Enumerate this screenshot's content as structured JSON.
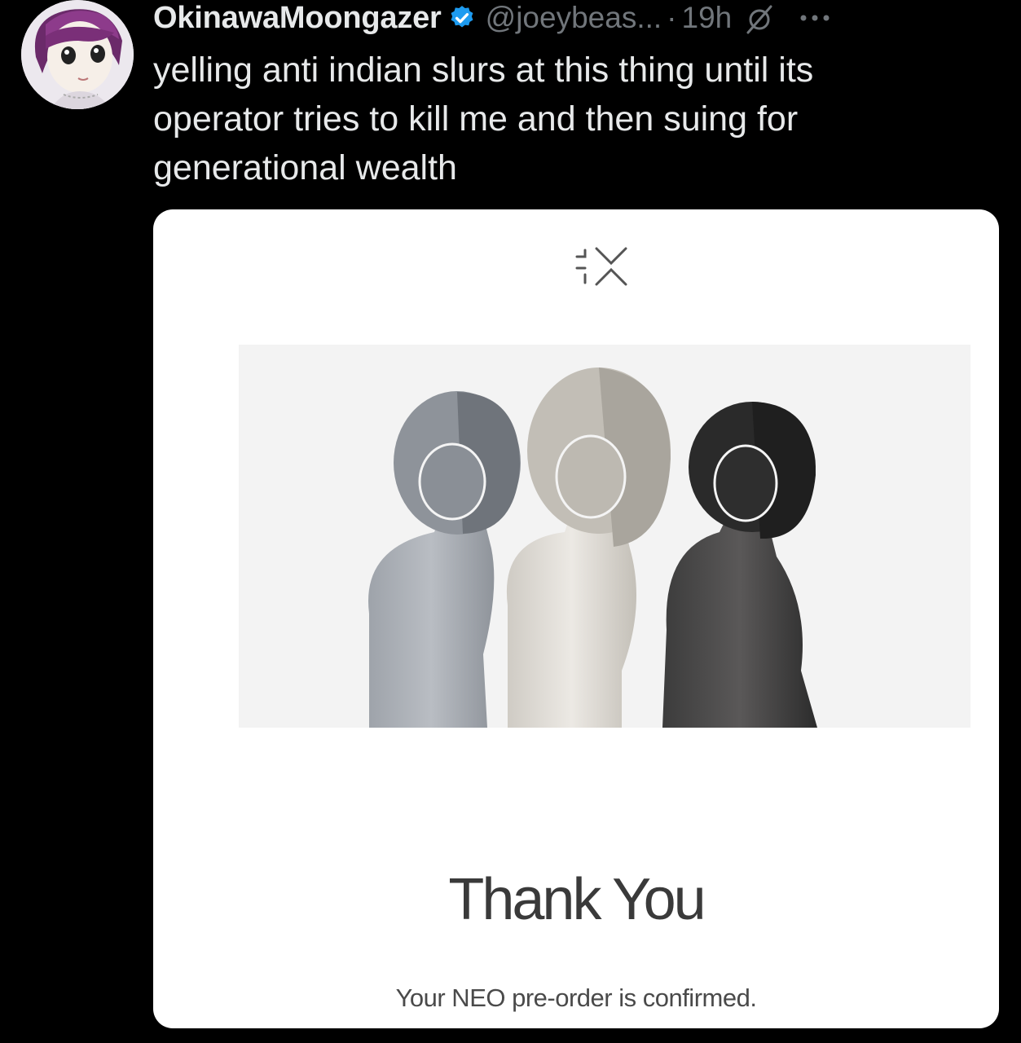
{
  "tweet": {
    "display_name": "OkinawaMoongazer",
    "handle": "@joeybeas...",
    "separator": "·",
    "timestamp": "19h",
    "text": "yelling anti indian slurs at this thing until its operator tries to kill me and then suing for generational wealth",
    "icons": {
      "verified": "verified-badge-icon",
      "grok": "grok-icon",
      "more": "more-options-icon"
    },
    "colors": {
      "verified": "#1d9bf0",
      "secondary_text": "#71767b"
    }
  },
  "media_card": {
    "brand_logo": "1X-logo",
    "heading": "Thank You",
    "message": "Your NEO pre-order is confirmed."
  }
}
